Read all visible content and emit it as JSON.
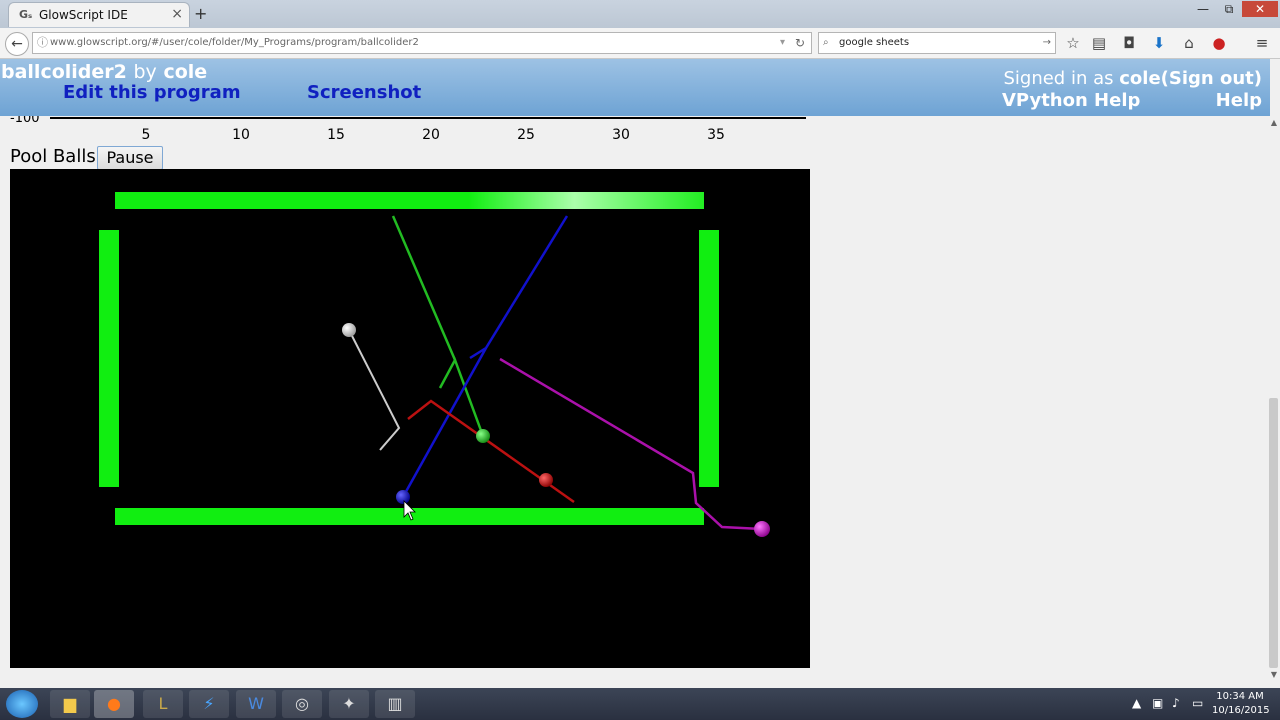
{
  "browser": {
    "tab_title": "GlowScript IDE",
    "tab_favicon": "Gₛ",
    "new_tab": "+",
    "window_controls": {
      "minimize": "—",
      "maximize": "⧉",
      "close": "✕"
    },
    "url_display": "www.glowscript.org/#/user/cole/folder/My_Programs/program/ballcolider2",
    "search_text": "google sheets",
    "toolbar_icons": [
      "star-icon",
      "reading-list-icon",
      "pocket-icon",
      "download-icon",
      "home-icon",
      "adblock-icon",
      "menu-icon"
    ]
  },
  "header": {
    "program_name": "ballcolider2",
    "by_label": "by",
    "author": "cole",
    "edit_link": "Edit this program",
    "screenshot_link": "Screenshot",
    "signed_in_prefix": "Signed in as",
    "signed_in_user": "cole",
    "sign_out": "(Sign out)",
    "vpython_help": "VPython Help",
    "help": "Help"
  },
  "graph": {
    "y_label": "-100",
    "x_ticks": [
      "5",
      "10",
      "15",
      "20",
      "25",
      "30",
      "35"
    ]
  },
  "page": {
    "title": "Pool Balls",
    "pause_button": "Pause"
  },
  "scene": {
    "background": "#000000",
    "rail_color": "#11ee11",
    "balls": [
      {
        "name": "white-ball",
        "color": "#dddddd"
      },
      {
        "name": "green-ball",
        "color": "#22cc22"
      },
      {
        "name": "blue-ball",
        "color": "#1111dd"
      },
      {
        "name": "red-ball",
        "color": "#cc1111"
      },
      {
        "name": "magenta-ball",
        "color": "#cc11cc"
      }
    ]
  },
  "taskbar": {
    "apps": [
      "start-button",
      "file-explorer",
      "firefox",
      "league-of-legends",
      "heroes-of-the-storm",
      "word",
      "obs",
      "game-app",
      "audio-editor"
    ],
    "tray_icons": [
      "show-hidden-icon",
      "network-icon",
      "volume-icon",
      "action-center-icon"
    ],
    "time": "10:34 AM",
    "date": "10/16/2015"
  }
}
